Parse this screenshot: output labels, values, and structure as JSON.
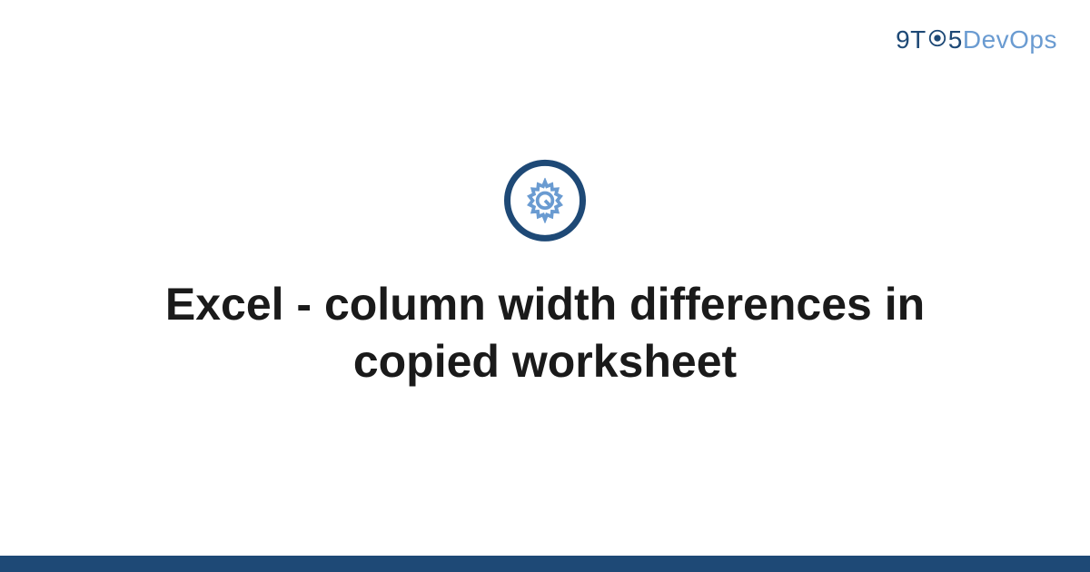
{
  "brand": {
    "prefix": "9T",
    "middle": "5",
    "suffix": "DevOps"
  },
  "title": "Excel - column width differences in copied worksheet",
  "colors": {
    "primary": "#1e4976",
    "accent": "#6a9bd1"
  }
}
